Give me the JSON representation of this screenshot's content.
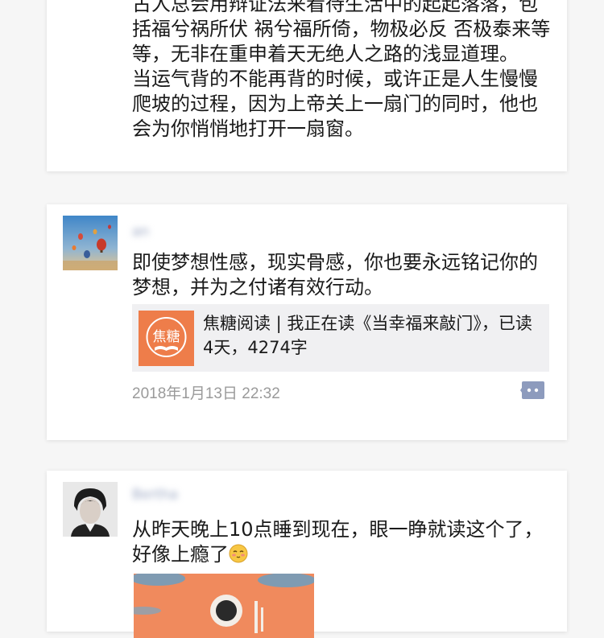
{
  "posts": [
    {
      "text": "古人总会用辩证法来看待生活中的起起落落，包括福兮祸所伏 祸兮福所倚，物极必反 否极泰来等等，无非在重申着天无绝人之路的浅显道理。\n当运气背的不能再背的时候，或许正是人生慢慢爬坡的过程，因为上帝关上一扇门的同时，他也会为你悄悄地打开一扇窗。"
    },
    {
      "username": "an",
      "text": "即使梦想性感，现实骨感，你也要永远铭记你的梦想，并为之付诸有效行动。",
      "share": {
        "logo_text": "焦糖",
        "title": "焦糖阅读 | 我正在读《当幸福来敲门》，已读4天，4274字"
      },
      "timestamp": "2018年1月13日 22:32"
    },
    {
      "username": "Bertha",
      "text": "从昨天晚上10点睡到现在，眼一睁就读这个了，好像上瘾了"
    }
  ],
  "colors": {
    "username": "#9aa6c2",
    "timestamp": "#9a9a9a",
    "comment_button": "#8d9bbd",
    "share_logo_bg": "#ee7d4a"
  },
  "icons": {
    "comment": "comment-dots-icon",
    "emoji": "blushing-face-emoji"
  }
}
